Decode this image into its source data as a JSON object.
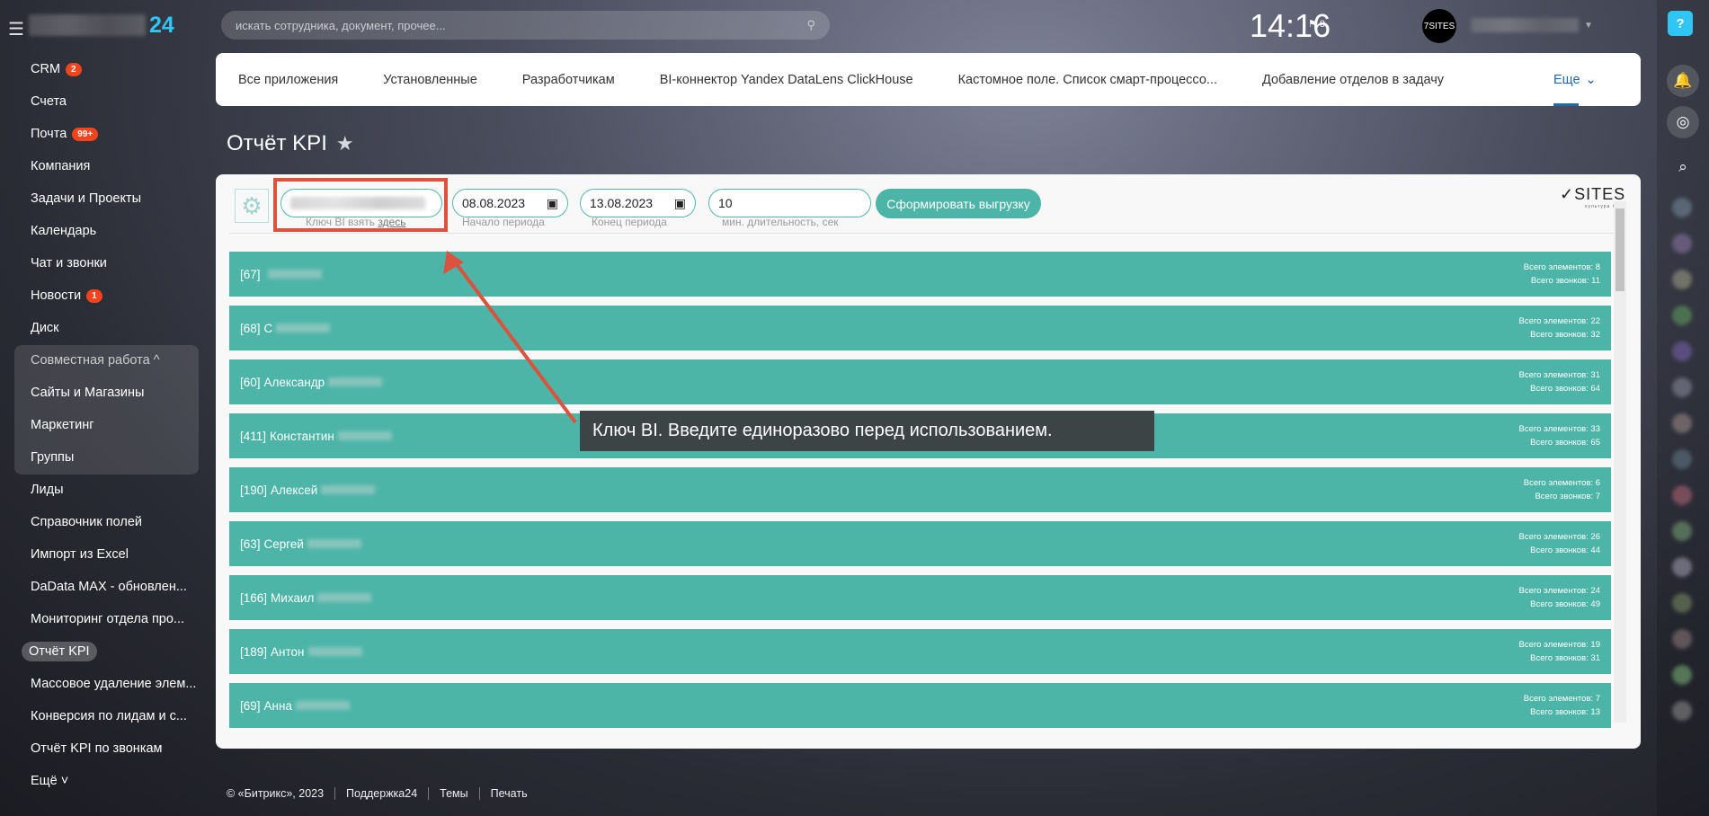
{
  "header": {
    "logo_suffix": "24",
    "search_placeholder": "искать сотрудника, документ, прочее...",
    "clock": "14:16",
    "flag_count": "0",
    "avatar_text": "7SITES"
  },
  "sidebar": {
    "items": [
      {
        "label": "CRM",
        "badge": "2"
      },
      {
        "label": "Счета"
      },
      {
        "label": "Почта",
        "badge": "99+"
      },
      {
        "label": "Компания"
      },
      {
        "label": "Задачи и Проекты"
      },
      {
        "label": "Календарь"
      },
      {
        "label": "Чат и звонки"
      },
      {
        "label": "Новости",
        "badge": "1"
      },
      {
        "label": "Диск"
      },
      {
        "label": "Совместная работа ^"
      },
      {
        "label": "Сайты и Магазины"
      },
      {
        "label": "Маркетинг"
      },
      {
        "label": "Группы"
      },
      {
        "label": "Лиды"
      },
      {
        "label": "Справочник полей"
      },
      {
        "label": "Импорт из Excel"
      },
      {
        "label": "DaData MAX - обновлен..."
      },
      {
        "label": "Мониторинг отдела про..."
      },
      {
        "label": "Отчёт KPI"
      },
      {
        "label": "Массовое удаление элем..."
      },
      {
        "label": "Конверсия по лидам и с..."
      },
      {
        "label": "Отчёт KPI по звонкам"
      },
      {
        "label": "Ещё ˅"
      }
    ]
  },
  "tabs": [
    "Все приложения",
    "Установленные",
    "Разработчикам",
    "BI-коннектор Yandex DataLens ClickHouse",
    "Кастомное поле. Список смарт-процессо...",
    "Добавление отделов в задачу"
  ],
  "tab_more": "Еще",
  "page_title": "Отчёт KPI",
  "toolbar": {
    "key_label": "Ключ BI взять ",
    "key_link": "здесь",
    "start_date": "08.08.2023",
    "start_label": "Начало периода",
    "end_date": "13.08.2023",
    "end_label": "Конец периода",
    "min_duration": "10",
    "min_label": "мин. длительность, сек",
    "generate_button": "Сформировать выгрузку",
    "brand": "SITES",
    "brand_sub": "культура CRM"
  },
  "rows": [
    {
      "id": "[67]",
      "name": "",
      "elements": "Всего элементов: 8",
      "calls": "Всего звонков: 11"
    },
    {
      "id": "[68]",
      "name": "С",
      "elements": "Всего элементов: 22",
      "calls": "Всего звонков: 32"
    },
    {
      "id": "[60]",
      "name": "Александр",
      "elements": "Всего элементов: 31",
      "calls": "Всего звонков: 64"
    },
    {
      "id": "[411]",
      "name": "Константин",
      "elements": "Всего элементов: 33",
      "calls": "Всего звонков: 65"
    },
    {
      "id": "[190]",
      "name": "Алексей",
      "elements": "Всего элементов: 6",
      "calls": "Всего звонков: 7"
    },
    {
      "id": "[63]",
      "name": "Сергей",
      "elements": "Всего элементов: 26",
      "calls": "Всего звонков: 44"
    },
    {
      "id": "[166]",
      "name": "Михаил",
      "elements": "Всего элементов: 24",
      "calls": "Всего звонков: 49"
    },
    {
      "id": "[189]",
      "name": "Антон",
      "elements": "Всего элементов: 19",
      "calls": "Всего звонков: 31"
    },
    {
      "id": "[69]",
      "name": "Анна",
      "elements": "Всего элементов: 7",
      "calls": "Всего звонков: 13"
    }
  ],
  "tooltip": "Ключ BI. Введите единоразово перед использованием.",
  "footer": [
    "© «Битрикс», 2023",
    "Поддержка24",
    "Темы",
    "Печать"
  ],
  "colors": {
    "accent": "#4db5a8",
    "highlight": "#d9533f",
    "badge": "#f4441b",
    "brand_blue": "#2fc6f6"
  }
}
